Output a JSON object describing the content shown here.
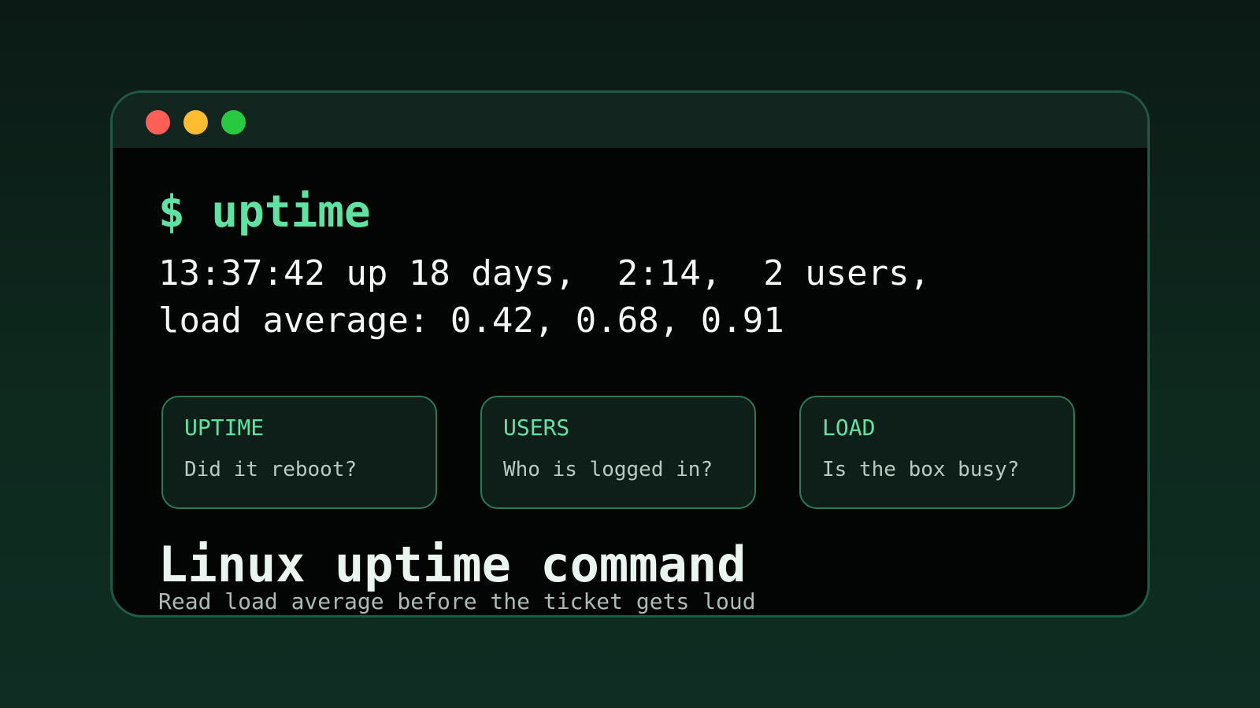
{
  "terminal": {
    "prompt": "$ uptime",
    "output_line1": "13:37:42 up 18 days,  2:14,  2 users,",
    "output_line2": "load average: 0.42, 0.68, 0.91"
  },
  "cards": [
    {
      "title": "UPTIME",
      "description": "Did it reboot?"
    },
    {
      "title": "USERS",
      "description": "Who is logged in?"
    },
    {
      "title": "LOAD",
      "description": "Is the box busy?"
    }
  ],
  "footer": {
    "heading": "Linux uptime command",
    "subheading": "Read load average before the ticket gets loud"
  },
  "colors": {
    "accent": "#5ee3a3",
    "close": "#ff5f57",
    "minimize": "#febc2e",
    "maximize": "#28c840"
  }
}
